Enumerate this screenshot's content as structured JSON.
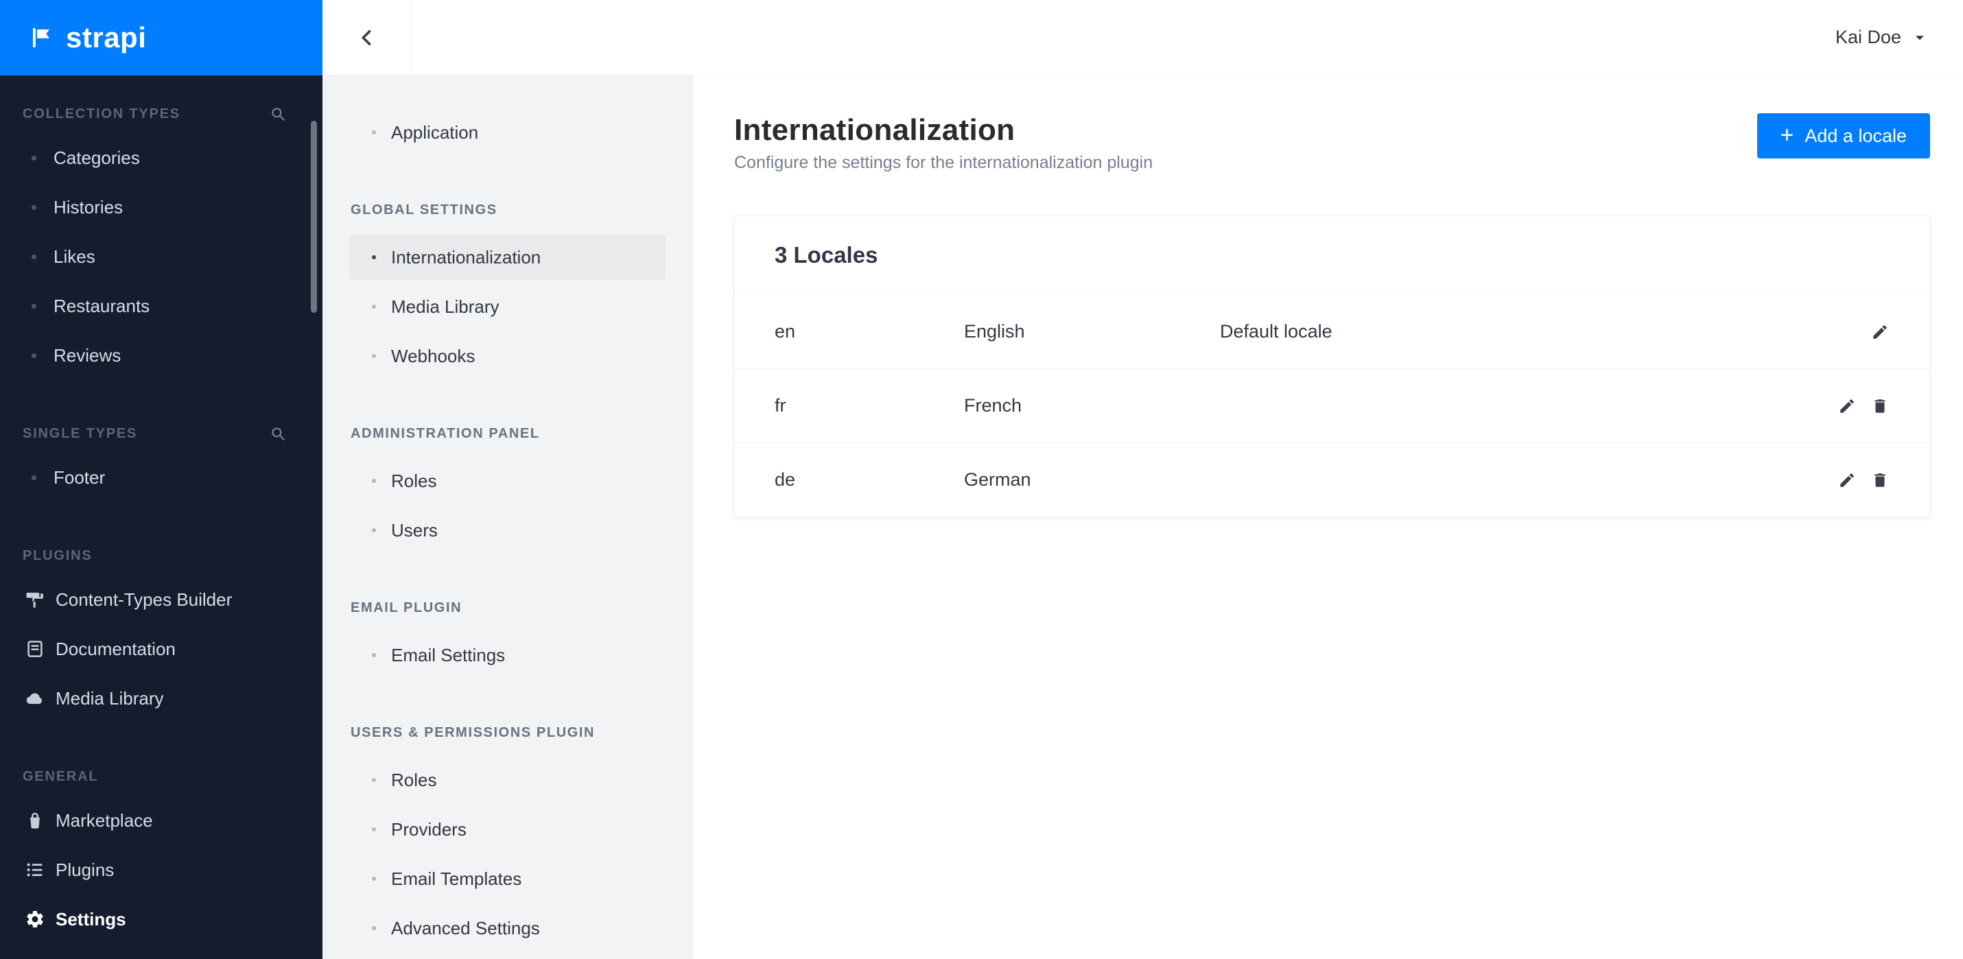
{
  "colors": {
    "accent": "#007eff",
    "sidebar_bg": "#151c2e",
    "subnav_bg": "#f2f3f4"
  },
  "brand": {
    "name": "strapi"
  },
  "topbar": {
    "user": "Kai Doe"
  },
  "sidebar": {
    "collection_types": {
      "label": "COLLECTION TYPES",
      "items": [
        "Categories",
        "Histories",
        "Likes",
        "Restaurants",
        "Reviews"
      ]
    },
    "single_types": {
      "label": "SINGLE TYPES",
      "items": [
        "Footer"
      ]
    },
    "plugins": {
      "label": "PLUGINS",
      "items": [
        "Content-Types Builder",
        "Documentation",
        "Media Library"
      ]
    },
    "general": {
      "label": "GENERAL",
      "items": [
        "Marketplace",
        "Plugins",
        "Settings"
      ]
    }
  },
  "settings_nav": {
    "application": "Application",
    "global_settings": {
      "label": "GLOBAL SETTINGS",
      "items": [
        "Internationalization",
        "Media Library",
        "Webhooks"
      ]
    },
    "admin_panel": {
      "label": "ADMINISTRATION PANEL",
      "items": [
        "Roles",
        "Users"
      ]
    },
    "email_plugin": {
      "label": "EMAIL PLUGIN",
      "items": [
        "Email Settings"
      ]
    },
    "users_permissions": {
      "label": "USERS & PERMISSIONS PLUGIN",
      "items": [
        "Roles",
        "Providers",
        "Email Templates",
        "Advanced Settings"
      ]
    }
  },
  "main": {
    "title": "Internationalization",
    "subtitle": "Configure the settings for the internationalization plugin",
    "add_locale_button": "Add a locale",
    "locales_card": {
      "title": "3 Locales",
      "rows": [
        {
          "code": "en",
          "name": "English",
          "note": "Default locale"
        },
        {
          "code": "fr",
          "name": "French",
          "note": ""
        },
        {
          "code": "de",
          "name": "German",
          "note": ""
        }
      ]
    }
  }
}
